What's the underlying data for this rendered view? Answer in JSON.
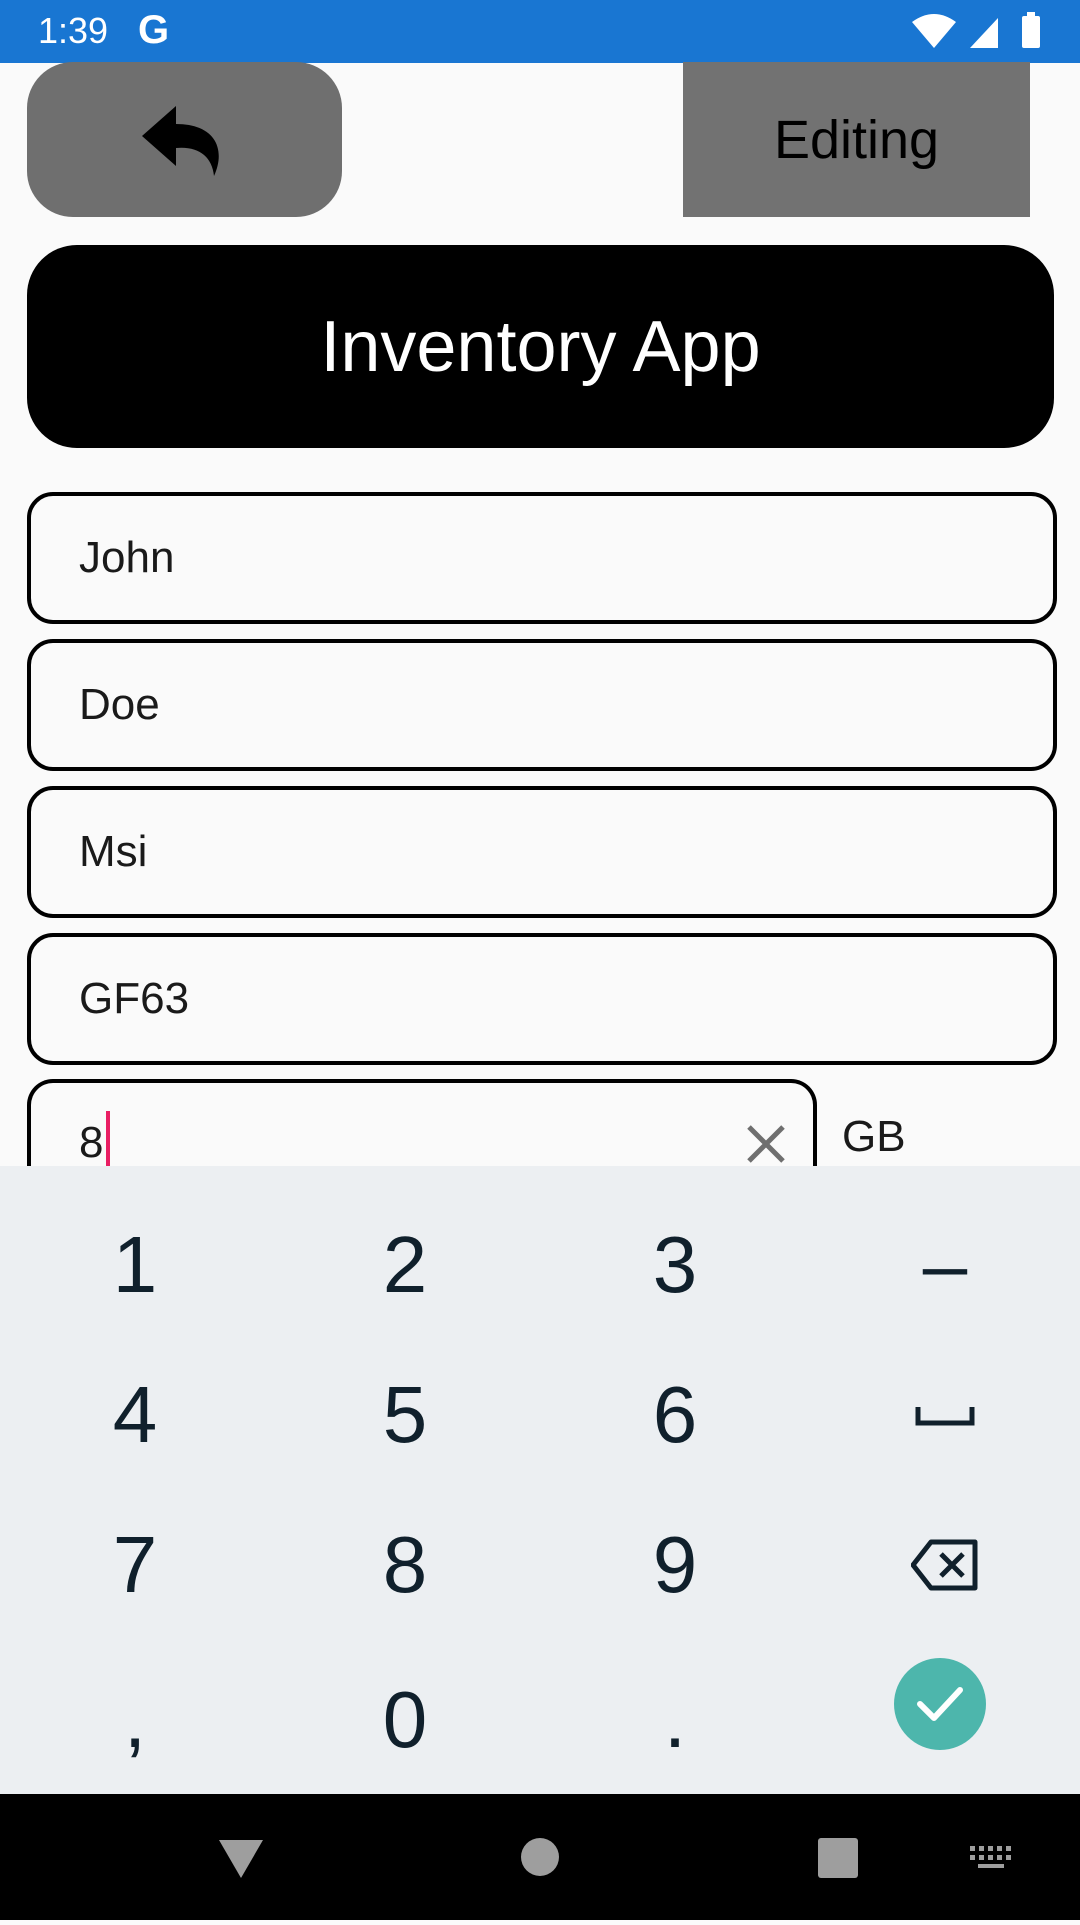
{
  "status_bar": {
    "time": "1:39",
    "google_glyph": "G",
    "icons": [
      "wifi-icon",
      "cell-signal-icon",
      "battery-icon"
    ]
  },
  "header": {
    "back_icon": "back-arrow-icon",
    "editing_label": "Editing",
    "title": "Inventory App"
  },
  "form": {
    "first_name": "John",
    "last_name": "Doe",
    "brand": "Msi",
    "model": "GF63",
    "ram_value": "8",
    "ram_unit": "GB"
  },
  "keyboard": {
    "keys": [
      "1",
      "2",
      "3",
      "–",
      "4",
      "5",
      "6",
      "␣",
      "7",
      "8",
      "9",
      "⌫",
      ",",
      "0",
      "."
    ],
    "done_icon": "check-icon"
  },
  "nav_bar": {
    "icons": [
      "back-triangle-icon",
      "home-circle-icon",
      "recents-square-icon",
      "keyboard-icon"
    ]
  },
  "colors": {
    "status_bar": "#1976d2",
    "title_bg": "#000000",
    "button_gray": "#6f6f6f",
    "accent": "#4db6ac",
    "cursor": "#e91e63"
  }
}
